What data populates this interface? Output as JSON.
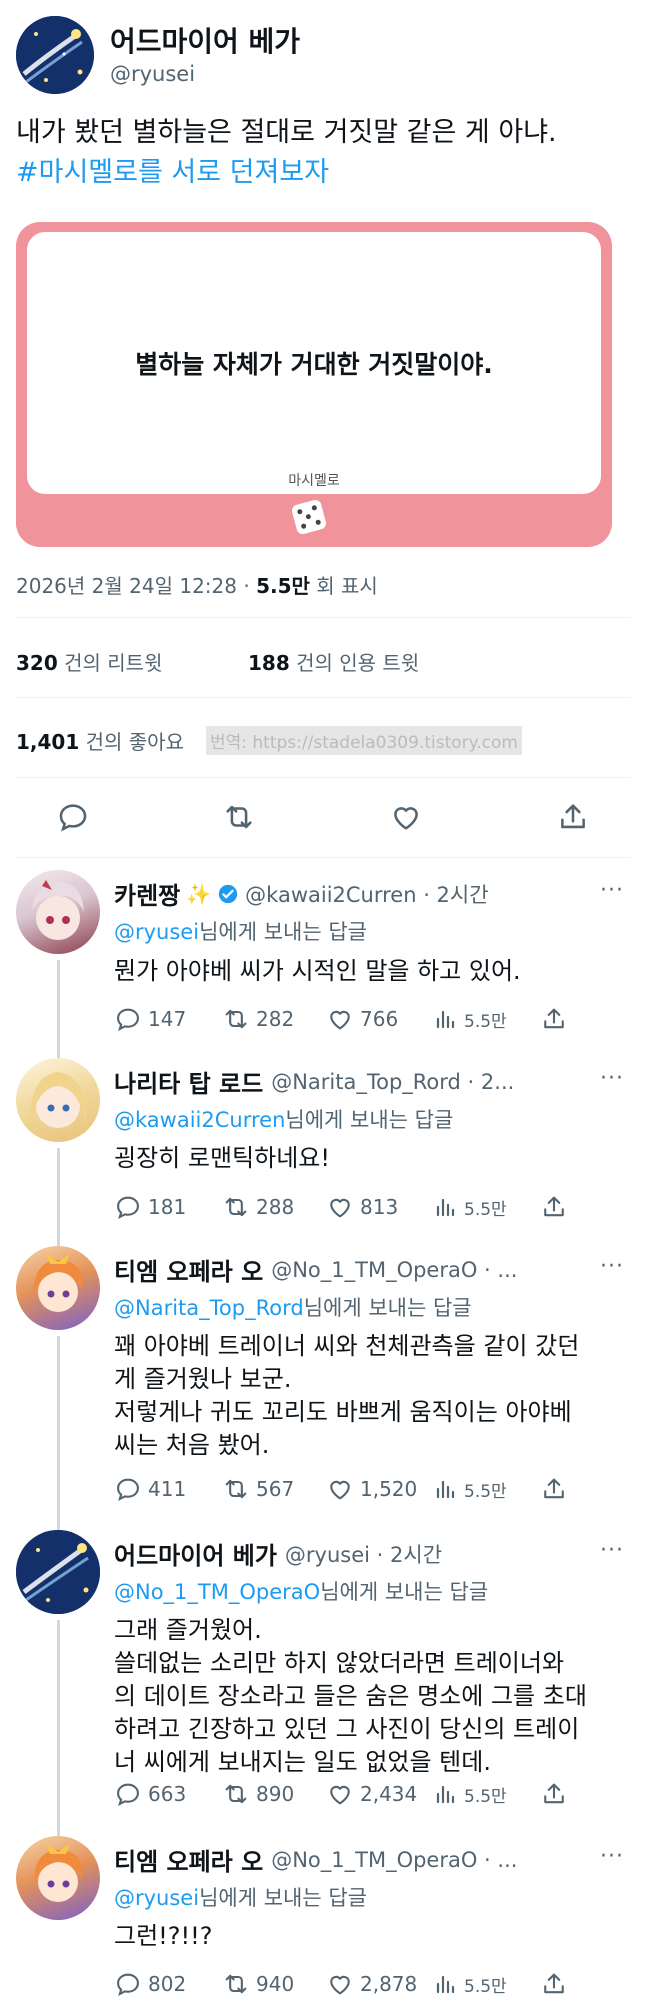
{
  "main_tweet": {
    "display_name": "어드마이어 베가",
    "handle": "@ryusei",
    "text_line1": "내가 봤던 별하늘은 절대로 거짓말 같은 게 아냐.",
    "hashtag": "#마시멜로를 서로 던져보자",
    "card_text": "별하늘 자체가 거대한 거짓말이야.",
    "card_brand": "마시멜로",
    "timestamp": "2026년 2월 24일  12:28",
    "views_value": "5.5만",
    "views_label": "회 표시",
    "retweets_count": "320",
    "retweets_label": "건의 리트윗",
    "quotes_count": "188",
    "quotes_label": "건의 인용 트윗",
    "likes_count": "1,401",
    "likes_label": "건의 좋아요",
    "translation_credit": "번역: https://stadela0309.tistory.com"
  },
  "replies": [
    {
      "name": "카렌짱",
      "handle_time": "@kawaii2Curren · 2시간",
      "reply_to": "@ryusei",
      "reply_suffix": "님에게 보내는 답글",
      "text": [
        "뭔가 아야베 씨가 시적인 말을 하고 있어."
      ],
      "replies": "147",
      "retweets": "282",
      "likes": "766",
      "views": "5.5만"
    },
    {
      "name": "나리타 탑 로드",
      "handle_time": "@Narita_Top_Rord · 2...",
      "reply_to": "@kawaii2Curren",
      "reply_suffix": "님에게 보내는 답글",
      "text": [
        "굉장히 로맨틱하네요!"
      ],
      "replies": "181",
      "retweets": "288",
      "likes": "813",
      "views": "5.5만"
    },
    {
      "name": "티엠 오페라 오",
      "handle_time": "@No_1_TM_OperaO · ...",
      "reply_to": "@Narita_Top_Rord",
      "reply_suffix": "님에게 보내는 답글",
      "text": [
        "꽤 아야베 트레이너 씨와 천체관측을 같이 갔던",
        "게 즐거웠나 보군.",
        "저렇게나 귀도 꼬리도 바쁘게 움직이는 아야베",
        "씨는 처음 봤어."
      ],
      "replies": "411",
      "retweets": "567",
      "likes": "1,520",
      "views": "5.5만"
    },
    {
      "name": "어드마이어 베가",
      "handle_time": "@ryusei · 2시간",
      "reply_to": "@No_1_TM_OperaO",
      "reply_suffix": "님에게 보내는 답글",
      "text": [
        "그래 즐거웠어.",
        "쓸데없는 소리만 하지 않았더라면 트레이너와",
        "의 데이트 장소라고 들은 숨은 명소에 그를 초대",
        "하려고 긴장하고 있던 그 사진이 당신의 트레이",
        "너 씨에게 보내지는 일도 없었을 텐데."
      ],
      "replies": "663",
      "retweets": "890",
      "likes": "2,434",
      "views": "5.5만"
    },
    {
      "name": "티엠 오페라 오",
      "handle_time": "@No_1_TM_OperaO · ...",
      "reply_to": "@ryusei",
      "reply_suffix": "님에게 보내는 답글",
      "text": [
        "그런!?!!?"
      ],
      "replies": "802",
      "retweets": "940",
      "likes": "2,878",
      "views": "5.5만"
    }
  ],
  "icons": {
    "reply": "reply-icon",
    "retweet": "retweet-icon",
    "like": "heart-icon",
    "share": "share-icon",
    "views": "views-icon",
    "more": "more-icon",
    "verified": "verified-badge-icon"
  }
}
